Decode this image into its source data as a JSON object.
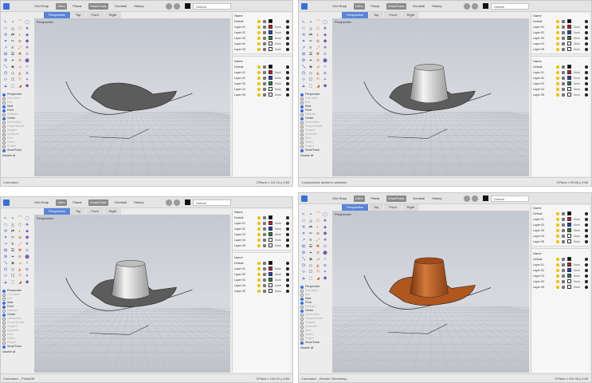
{
  "toolbar": {
    "osnaps": [
      "Grid Snap",
      "Ortho",
      "Planar",
      "SmartTrack",
      "Gumball",
      "History"
    ],
    "active_osnaps": [
      1,
      3
    ],
    "layer_label": "Default"
  },
  "tabs": [
    "Perspective",
    "Top",
    "Front",
    "Right"
  ],
  "active_tab": 0,
  "viewport_title": "Perspective",
  "snaps": [
    {
      "label": "Perspective",
      "on": true
    },
    {
      "label": "One plane",
      "on": false
    },
    {
      "label": "End",
      "on": false
    },
    {
      "label": "Near",
      "on": true
    },
    {
      "label": "Point",
      "on": true
    },
    {
      "label": "Midpoint",
      "on": false
    },
    {
      "label": "Center",
      "on": true
    },
    {
      "label": "Intersection",
      "on": false
    },
    {
      "label": "Perpendicular",
      "on": false
    },
    {
      "label": "Tangent",
      "on": false
    },
    {
      "label": "Quadrant",
      "on": false
    },
    {
      "label": "Knot",
      "on": false
    },
    {
      "label": "Vertex",
      "on": false
    },
    {
      "label": "Project",
      "on": false
    },
    {
      "label": "SmartTrack",
      "on": true
    }
  ],
  "deselect_label": "Disable all",
  "layers_title": "Name",
  "layers_top": [
    {
      "name": "Default",
      "material": "",
      "color": "#000000"
    },
    {
      "name": "Layer 01",
      "material": "Dunk",
      "color": "#d11a2a"
    },
    {
      "name": "Layer 02",
      "material": "Dunk",
      "color": "#2a3fd6"
    },
    {
      "name": "Layer 03",
      "material": "Dunk",
      "color": "#1a8c3a"
    },
    {
      "name": "Layer 04",
      "material": "Dunk",
      "color": "#ffffff"
    },
    {
      "name": "Layer 05",
      "material": "Dunk",
      "color": "#ffffff"
    }
  ],
  "layers_bottom": [
    {
      "name": "Default",
      "material": "",
      "color": "#000000"
    },
    {
      "name": "Layer 01",
      "material": "Dunk",
      "color": "#d11a2a"
    },
    {
      "name": "Layer 02",
      "material": "Dunk",
      "color": "#2a3fd6"
    },
    {
      "name": "Layer 03",
      "material": "Dunk",
      "color": "#1a8c3a"
    },
    {
      "name": "Layer 04",
      "material": "Dunk",
      "color": "#ffffff"
    },
    {
      "name": "Layer 05",
      "material": "Dunk",
      "color": "#ffffff"
    }
  ],
  "shots": [
    {
      "status": "Command:",
      "coords": "CPlane  x 112.16  y 0.85",
      "scene": "brim"
    },
    {
      "status": "1 polysurface added to selection",
      "coords": "CPlane  x 99.85  y 0.85",
      "scene": "crown"
    },
    {
      "status": "Command: _PointsOff",
      "coords": "CPlane  x 104.02  y 0.85",
      "scene": "crown"
    },
    {
      "status": "Command: _Render. Rendering...",
      "coords": "CPlane  x 104.98  y 0.85",
      "scene": "rendered"
    }
  ],
  "colors": {
    "accent": "#5b84d8",
    "brim": "#5c5c5c",
    "crown": "#d9d9d9",
    "render": "#b0561f"
  }
}
